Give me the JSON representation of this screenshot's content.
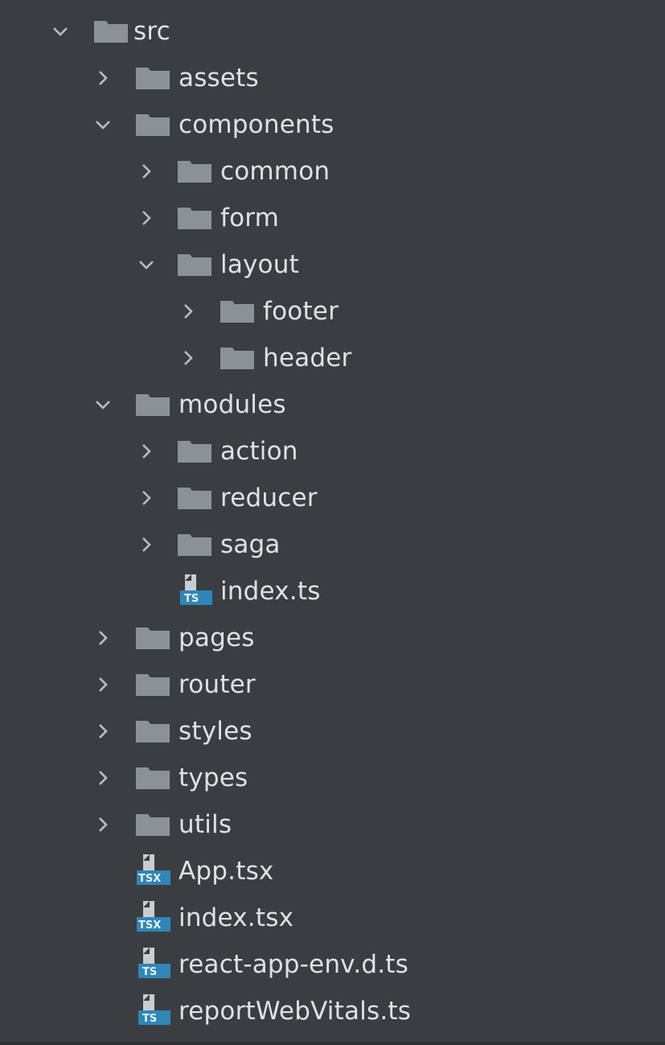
{
  "colors": {
    "background": "#3b3e40",
    "folder": "#8a9298",
    "text": "#dfe2e4",
    "arrow": "#b9bdc0",
    "ts_badge": "#2f86b8"
  },
  "tree": {
    "src": {
      "label": "src",
      "state": "expanded"
    },
    "assets": {
      "label": "assets",
      "state": "collapsed"
    },
    "components": {
      "label": "components",
      "state": "expanded"
    },
    "common": {
      "label": "common",
      "state": "collapsed"
    },
    "form": {
      "label": "form",
      "state": "collapsed"
    },
    "layout": {
      "label": "layout",
      "state": "expanded"
    },
    "footer": {
      "label": "footer",
      "state": "collapsed"
    },
    "header": {
      "label": "header",
      "state": "collapsed"
    },
    "modules": {
      "label": "modules",
      "state": "expanded"
    },
    "action": {
      "label": "action",
      "state": "collapsed"
    },
    "reducer": {
      "label": "reducer",
      "state": "collapsed"
    },
    "saga": {
      "label": "saga",
      "state": "collapsed"
    },
    "modules_index": {
      "label": "index.ts",
      "badge": "TS"
    },
    "pages": {
      "label": "pages",
      "state": "collapsed"
    },
    "router": {
      "label": "router",
      "state": "collapsed"
    },
    "styles": {
      "label": "styles",
      "state": "collapsed"
    },
    "types": {
      "label": "types",
      "state": "collapsed"
    },
    "utils": {
      "label": "utils",
      "state": "collapsed"
    },
    "app_tsx": {
      "label": "App.tsx",
      "badge": "TSX"
    },
    "index_tsx": {
      "label": "index.tsx",
      "badge": "TSX"
    },
    "react_app_env": {
      "label": "react-app-env.d.ts",
      "badge": "TS"
    },
    "report_web_vitals": {
      "label": "reportWebVitals.ts",
      "badge": "TS"
    }
  }
}
